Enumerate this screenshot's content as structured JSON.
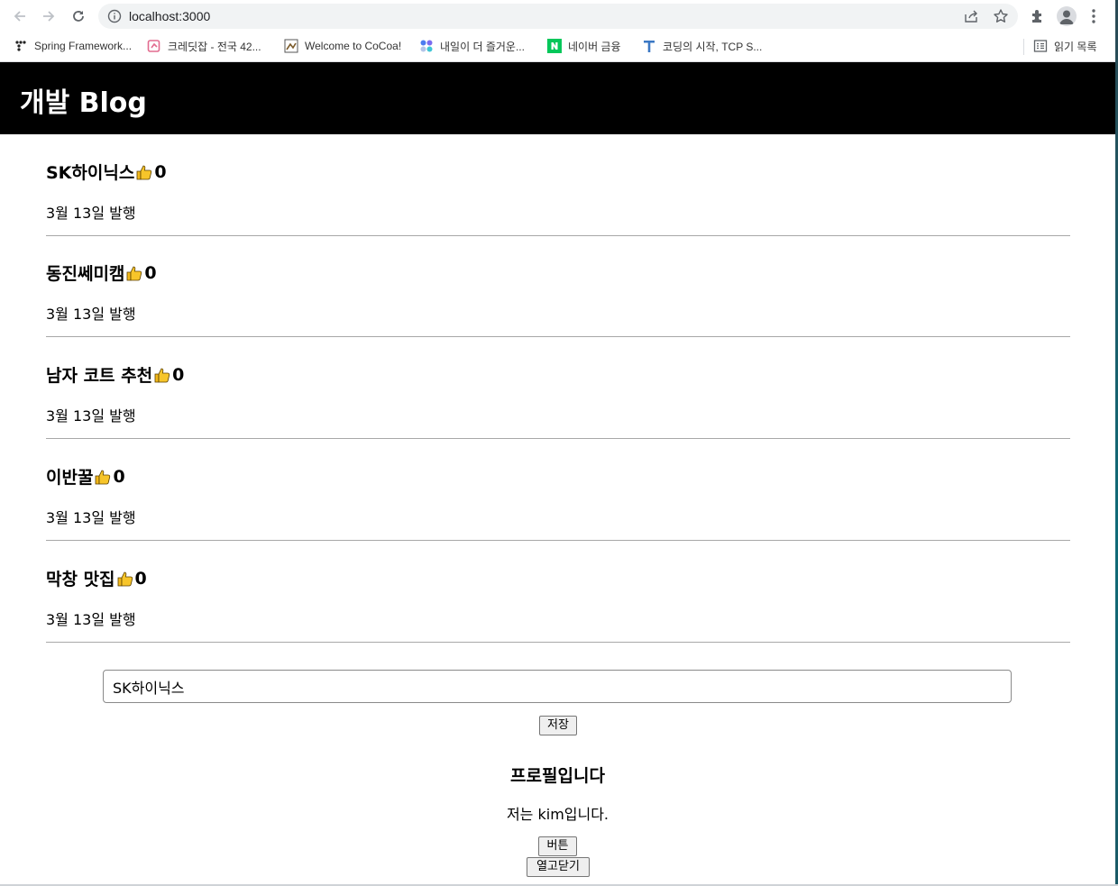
{
  "browser": {
    "url": "localhost:3000",
    "bookmarks": [
      {
        "label": "Spring Framework...",
        "icon": "spring-dots-icon"
      },
      {
        "label": "크레딧잡 - 전국 42...",
        "icon": "creditjob-icon"
      },
      {
        "label": "Welcome to CoCoa!",
        "icon": "cocoa-icon"
      },
      {
        "label": "내일이 더 즐거운...",
        "icon": "colorful-dots-icon"
      },
      {
        "label": "네이버 금융",
        "icon": "naver-icon"
      },
      {
        "label": "코딩의 시작, TCP S...",
        "icon": "tcp-school-icon"
      }
    ],
    "reading_list": "읽기 목록"
  },
  "header": {
    "title": "개발 Blog"
  },
  "posts": [
    {
      "title": "SK하이닉스",
      "likes": "0",
      "date": "3월 13일 발행"
    },
    {
      "title": "동진쎄미캠",
      "likes": "0",
      "date": "3월 13일 발행"
    },
    {
      "title": "남자 코트 추천",
      "likes": "0",
      "date": "3월 13일 발행"
    },
    {
      "title": "이반꿀",
      "likes": "0",
      "date": "3월 13일 발행"
    },
    {
      "title": "막창 맛집",
      "likes": "0",
      "date": "3월 13일 발행"
    }
  ],
  "input": {
    "value": "SK하이닉스"
  },
  "save_button": "저장",
  "profile": {
    "title": "프로필입니다",
    "text": "저는 kim입니다.",
    "button": "버튼"
  },
  "toggle_button": "열고닫기",
  "colors": {
    "header_bg": "#000000",
    "header_text": "#ffffff",
    "divider": "#a8a8a8"
  }
}
